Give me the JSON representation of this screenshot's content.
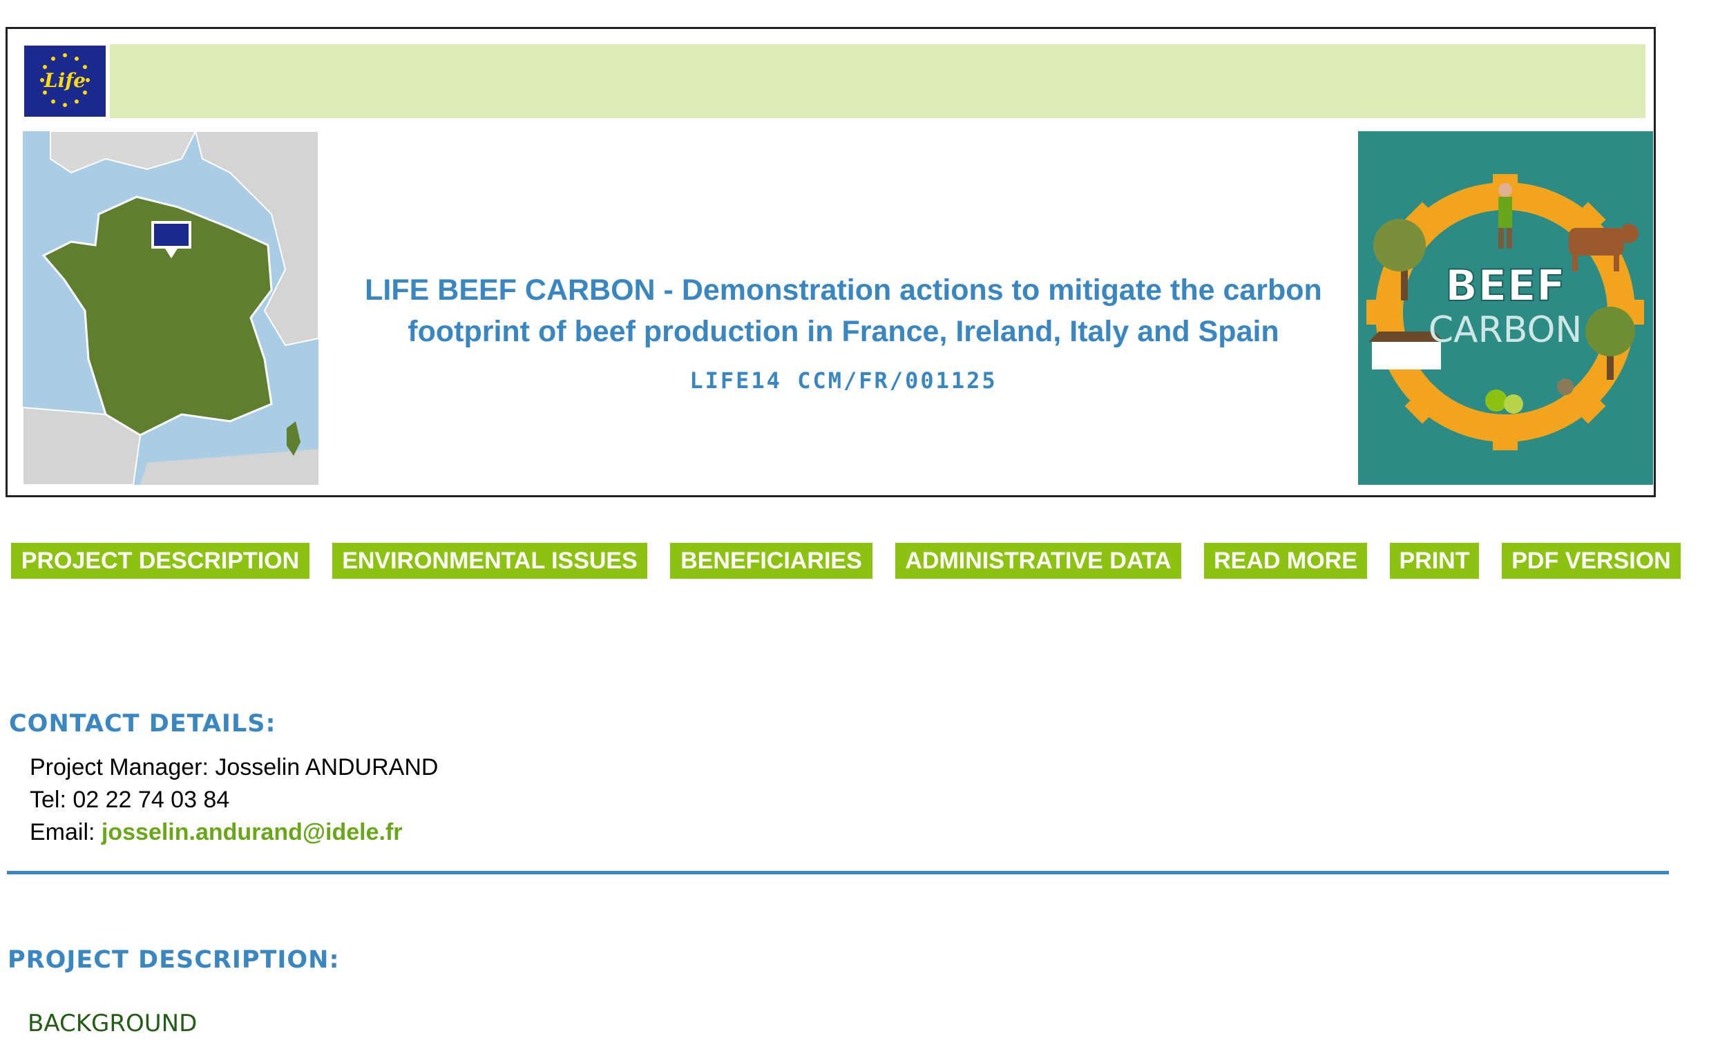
{
  "header": {
    "logo_text": "Life",
    "title": "LIFE BEEF CARBON - Demonstration actions to mitigate the carbon footprint of beef production in France, Ireland, Italy and Spain",
    "project_code": "LIFE14 CCM/FR/001125",
    "beef_logo": {
      "line1": "BEEF",
      "line2": "CARBON"
    },
    "colors": {
      "title": "#3a86c0",
      "topbar": "#ddebb5",
      "map_land": "#5f7f2e",
      "map_sea": "#a9cde4",
      "beef_bg": "#2d8b86",
      "gear": "#f2a51c"
    }
  },
  "nav": {
    "items": [
      {
        "label": "PROJECT DESCRIPTION"
      },
      {
        "label": "ENVIRONMENTAL ISSUES"
      },
      {
        "label": "BENEFICIARIES"
      },
      {
        "label": "ADMINISTRATIVE DATA"
      },
      {
        "label": "READ MORE"
      },
      {
        "label": "PRINT"
      },
      {
        "label": "PDF VERSION"
      }
    ],
    "color": "#8cc211"
  },
  "contact": {
    "heading": "CONTACT DETAILS:",
    "manager_label": "Project Manager:",
    "manager_name": "Josselin ANDURAND",
    "tel_label": "Tel:",
    "tel": "02 22 74 03 84",
    "email_label": "Email:",
    "email": "josselin.andurand@idele.fr"
  },
  "description": {
    "heading": "PROJECT DESCRIPTION:",
    "subheading": "BACKGROUND"
  }
}
